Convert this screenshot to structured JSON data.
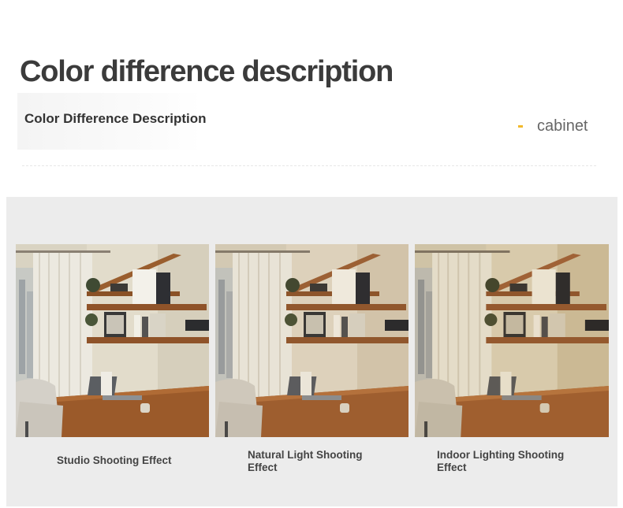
{
  "header": {
    "title": "Color difference description",
    "subtitle": "Color Difference Description",
    "category": "cabinet"
  },
  "colors": {
    "accent": "#f2b92b",
    "panel": "#ececec",
    "title": "#3b3b3b"
  },
  "gallery": [
    {
      "caption": "Studio Shooting Effect",
      "tone": "studio"
    },
    {
      "caption": "Natural Light Shooting Effect",
      "tone": "natural"
    },
    {
      "caption": "Indoor Lighting Shooting Effect",
      "tone": "indoor"
    }
  ]
}
